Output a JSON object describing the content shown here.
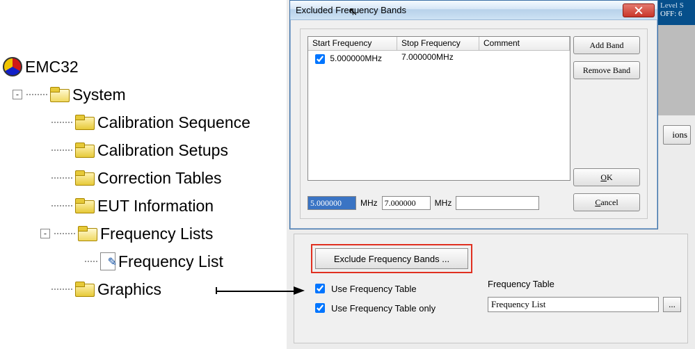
{
  "tree": {
    "root": "EMC32",
    "system": "System",
    "items": [
      "Calibration Sequence",
      "Calibration Setups",
      "Correction Tables",
      "EUT Information",
      "Frequency Lists",
      "Frequency List",
      "Graphics"
    ]
  },
  "page": {
    "exclude_button": "Exclude Frequency Bands ...",
    "use_ft": "Use Frequency Table",
    "use_ft_only": "Use Frequency Table only",
    "ft_label": "Frequency Table",
    "ft_value": "Frequency List",
    "browse": "...",
    "side_level": "Level S",
    "side_off": "OFF: 6",
    "ions": "ions"
  },
  "dialog": {
    "title": "Excluded Frequency Bands",
    "columns": {
      "start": "Start Frequency",
      "stop": "Stop Frequency",
      "comment": "Comment"
    },
    "rows": [
      {
        "enabled": true,
        "start": "5.000000MHz",
        "stop": "7.000000MHz",
        "comment": ""
      }
    ],
    "start_value": "5.000000",
    "start_unit": "MHz",
    "stop_value": "7.000000",
    "stop_unit": "MHz",
    "comment_value": "",
    "buttons": {
      "add": "Add Band",
      "remove": "Remove Band",
      "ok": "OK",
      "cancel": "Cancel"
    }
  }
}
